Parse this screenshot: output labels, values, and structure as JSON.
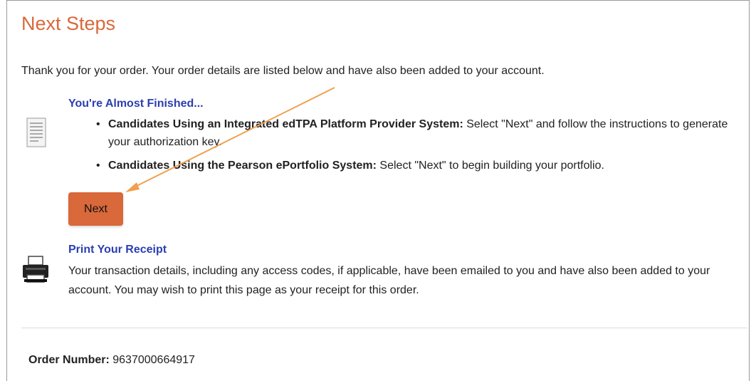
{
  "page": {
    "title": "Next Steps",
    "intro": "Thank you for your order. Your order details are listed below and have also been added to your account."
  },
  "almost_finished": {
    "heading": "You're Almost Finished...",
    "icon": "document-icon",
    "items": [
      {
        "bold": "Candidates Using an Integrated edTPA Platform Provider System:",
        "text": " Select \"Next\" and follow the instructions to generate your authorization key."
      },
      {
        "bold": "Candidates Using the Pearson ePortfolio System:",
        "text": " Select \"Next\" to begin building your portfolio."
      }
    ],
    "next_label": "Next"
  },
  "receipt": {
    "heading": "Print Your Receipt",
    "icon": "printer-icon",
    "text": "Your transaction details, including any access codes, if applicable, have been emailed to you and have also been added to your account. You may wish to print this page as your receipt for this order."
  },
  "order": {
    "label": "Order Number:",
    "value": "9637000664917"
  },
  "colors": {
    "title": "#d9683a",
    "heading": "#2b3fb0",
    "button": "#d9683a",
    "annotation_arrow": "#f0a050"
  }
}
